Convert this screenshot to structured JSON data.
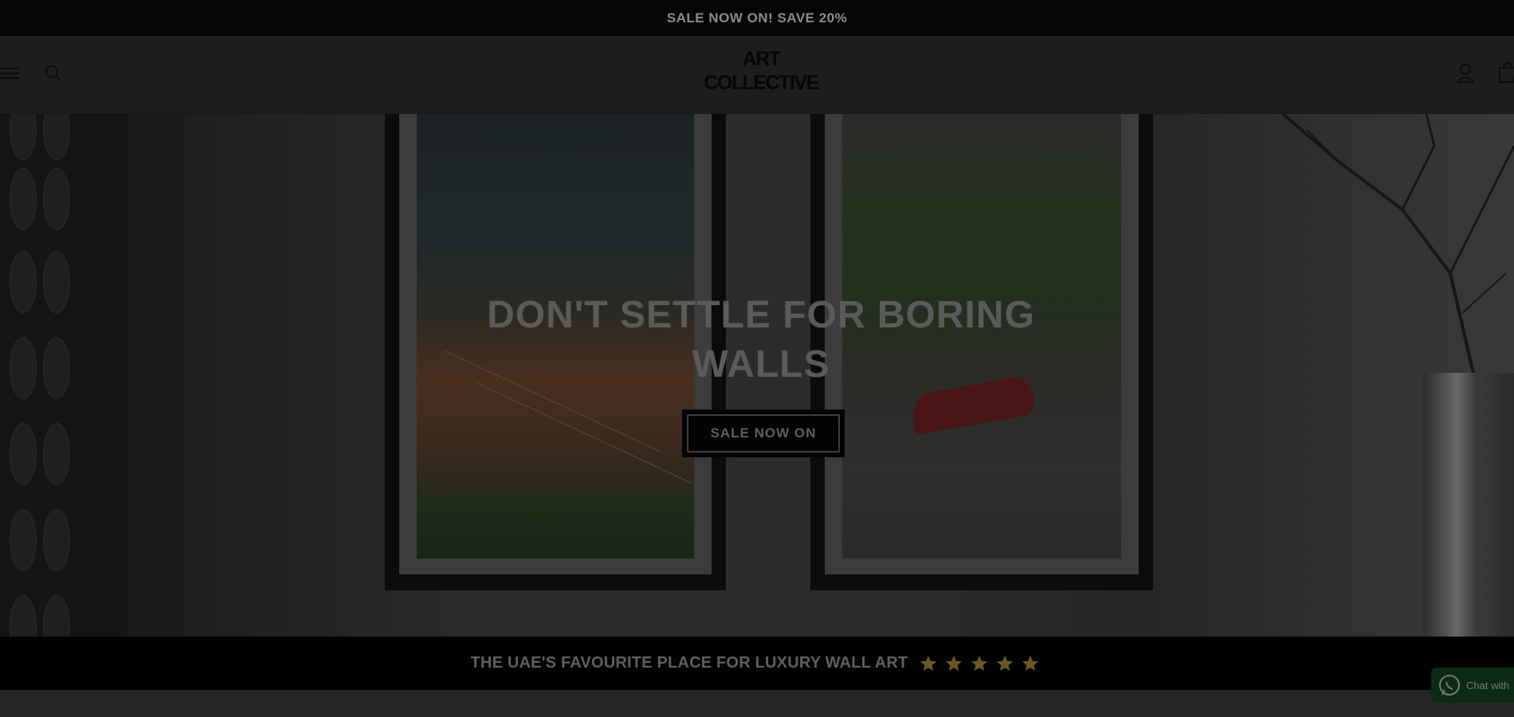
{
  "announcement": {
    "text": "SALE NOW ON! SAVE 20%"
  },
  "header": {
    "logo_line1": "ART",
    "logo_line2": "COLLECTIVE",
    "icons": [
      "menu-icon",
      "search-icon",
      "account-icon",
      "cart-icon"
    ]
  },
  "hero": {
    "heading": "DON'T SETTLE FOR BORING WALLS",
    "cta_label": "SALE NOW ON"
  },
  "reviews": {
    "text": "THE UAE'S FAVOURITE PLACE FOR LUXURY WALL ART",
    "rating": 5,
    "star_color": "#6b5a1e"
  },
  "chat": {
    "label": "Chat with",
    "icon": "whatsapp-icon",
    "color": "#0c2a14"
  }
}
